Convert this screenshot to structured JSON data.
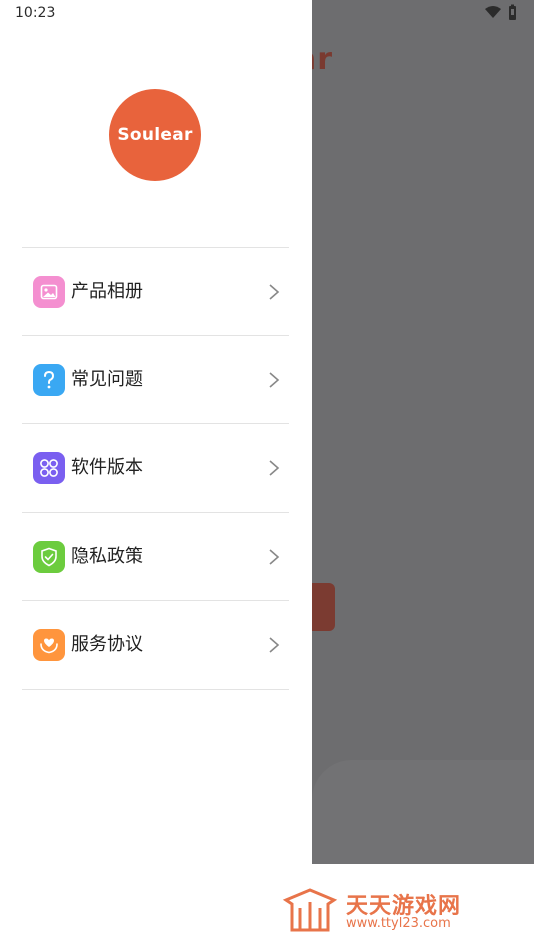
{
  "status_bar": {
    "time": "10:23"
  },
  "background_app": {
    "title_fragment": "ar"
  },
  "drawer": {
    "logo_text": "Soulear",
    "menu": [
      {
        "label": "产品相册",
        "icon": "image-icon",
        "color": "#f48fd0"
      },
      {
        "label": "常见问题",
        "icon": "question-icon",
        "color": "#3aa8f3"
      },
      {
        "label": "软件版本",
        "icon": "apps-icon",
        "color": "#7a5ff0"
      },
      {
        "label": "隐私政策",
        "icon": "shield-icon",
        "color": "#6ccc3e"
      },
      {
        "label": "服务协议",
        "icon": "heart-hands-icon",
        "color": "#ff953d"
      }
    ]
  },
  "watermark": {
    "title": "天天游戏网",
    "url": "www.ttyl23.com"
  },
  "colors": {
    "logo": "#e8633c",
    "backdrop": "#6d6d6f",
    "watermark": "#e8744a"
  }
}
